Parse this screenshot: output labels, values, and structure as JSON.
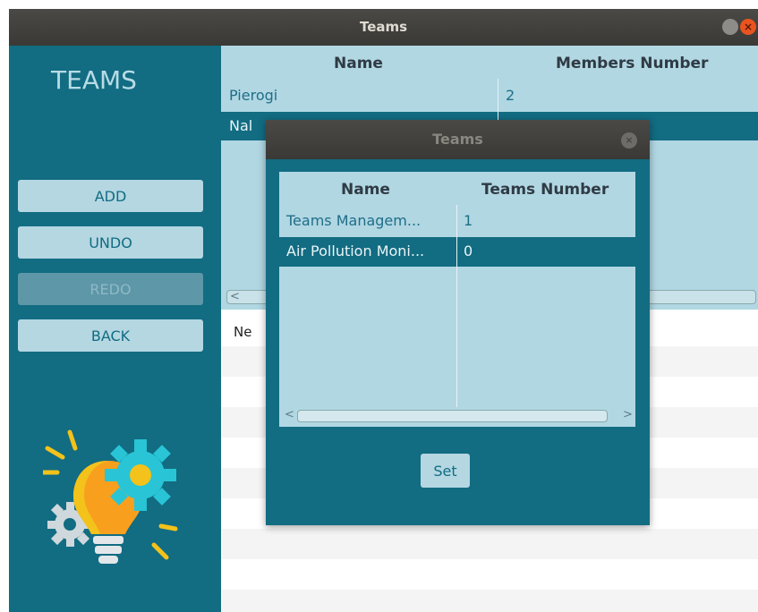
{
  "window": {
    "title": "Teams",
    "close_glyph": "×"
  },
  "sidebar": {
    "heading": "TEAMS",
    "buttons": [
      {
        "label": "ADD",
        "enabled": true
      },
      {
        "label": "UNDO",
        "enabled": true
      },
      {
        "label": "REDO",
        "enabled": false
      },
      {
        "label": "BACK",
        "enabled": true
      }
    ],
    "illustration": "lightbulb-gears-icon"
  },
  "main_table": {
    "columns": [
      "Name",
      "Members Number"
    ],
    "rows": [
      {
        "name": "Pierogi",
        "members": "2"
      },
      {
        "name": "Nal",
        "members": ""
      }
    ],
    "selected_row": 1,
    "scroll_left_glyph": "<"
  },
  "lower_list": {
    "visible_text": "Ne"
  },
  "dialog": {
    "title": "Teams",
    "close_glyph": "×",
    "columns": [
      "Name",
      "Teams Number"
    ],
    "rows": [
      {
        "name": "Teams Managem...",
        "teams": "1"
      },
      {
        "name": "Air Pollution Moni...",
        "teams": "0"
      }
    ],
    "selected_row": 1,
    "scroll_left_glyph": "<",
    "scroll_right_glyph": ">",
    "set_label": "Set"
  },
  "colors": {
    "accent": "#126c82",
    "panel": "#b1d7e3",
    "button": "#b4d7e2",
    "titlebar": "#3c3b37",
    "close": "#e9541f"
  }
}
